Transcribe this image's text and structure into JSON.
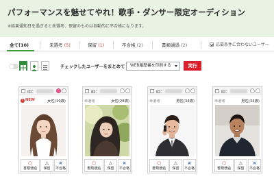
{
  "header": {
    "title": "パフォーマンスを魅せてやれ！歌手・ダンサー限定オーディション",
    "subtitle": "※結果通知日を過ぎると未選考、保留のものは自動的に不合格になります。"
  },
  "tabs": [
    {
      "label": "全て",
      "count": "(10)",
      "active": true,
      "count_color": "normal"
    },
    {
      "label": "未選考",
      "count": "(5)",
      "active": false,
      "count_color": "red"
    },
    {
      "label": "保留",
      "count": "(1)",
      "active": false,
      "count_color": "red"
    },
    {
      "label": "不合格",
      "count": "(2)",
      "active": false,
      "count_color": "normal"
    },
    {
      "label": "書類通過",
      "count": "(2)",
      "active": false,
      "count_color": "normal"
    }
  ],
  "mismatch_filter": {
    "label": "応募条件に合わないユーザー",
    "checked": true
  },
  "toolbar": {
    "bulk_label": "チェックしたユーザーをまとめて",
    "action_select_value": "WEB履歴書を印刷する",
    "run_label": "実行"
  },
  "cards": [
    {
      "id_label": "ID：",
      "status": "NEW",
      "is_new": true,
      "gender_age": "女性(19歳)",
      "photo": "woman-long-hair-photo",
      "favorite": true
    },
    {
      "id_label": "ID：",
      "status": "未選考",
      "is_new": false,
      "gender_age": "女性(28歳)",
      "photo": "woman-outdoor-photo",
      "favorite": false
    },
    {
      "id_label": "ID：",
      "status": "未選考",
      "is_new": false,
      "gender_age": "男性(34歳)",
      "photo": "man-phone-photo",
      "favorite": false
    },
    {
      "id_label": "ID：",
      "status": "未選考",
      "is_new": false,
      "gender_age": "男性(34歳)",
      "photo": "man-casual-photo",
      "favorite": false
    }
  ],
  "card_actions": {
    "pass": {
      "symbol": "○",
      "label": "書類通過"
    },
    "hold": {
      "symbol": "△",
      "label": "保留"
    },
    "fail": {
      "symbol": "×",
      "label": "不合格"
    }
  },
  "colors": {
    "accent_green": "#2f8d3c",
    "header_bg": "#e9f3e4",
    "run_red": "#d9202b",
    "new_red": "#d13a2f"
  }
}
